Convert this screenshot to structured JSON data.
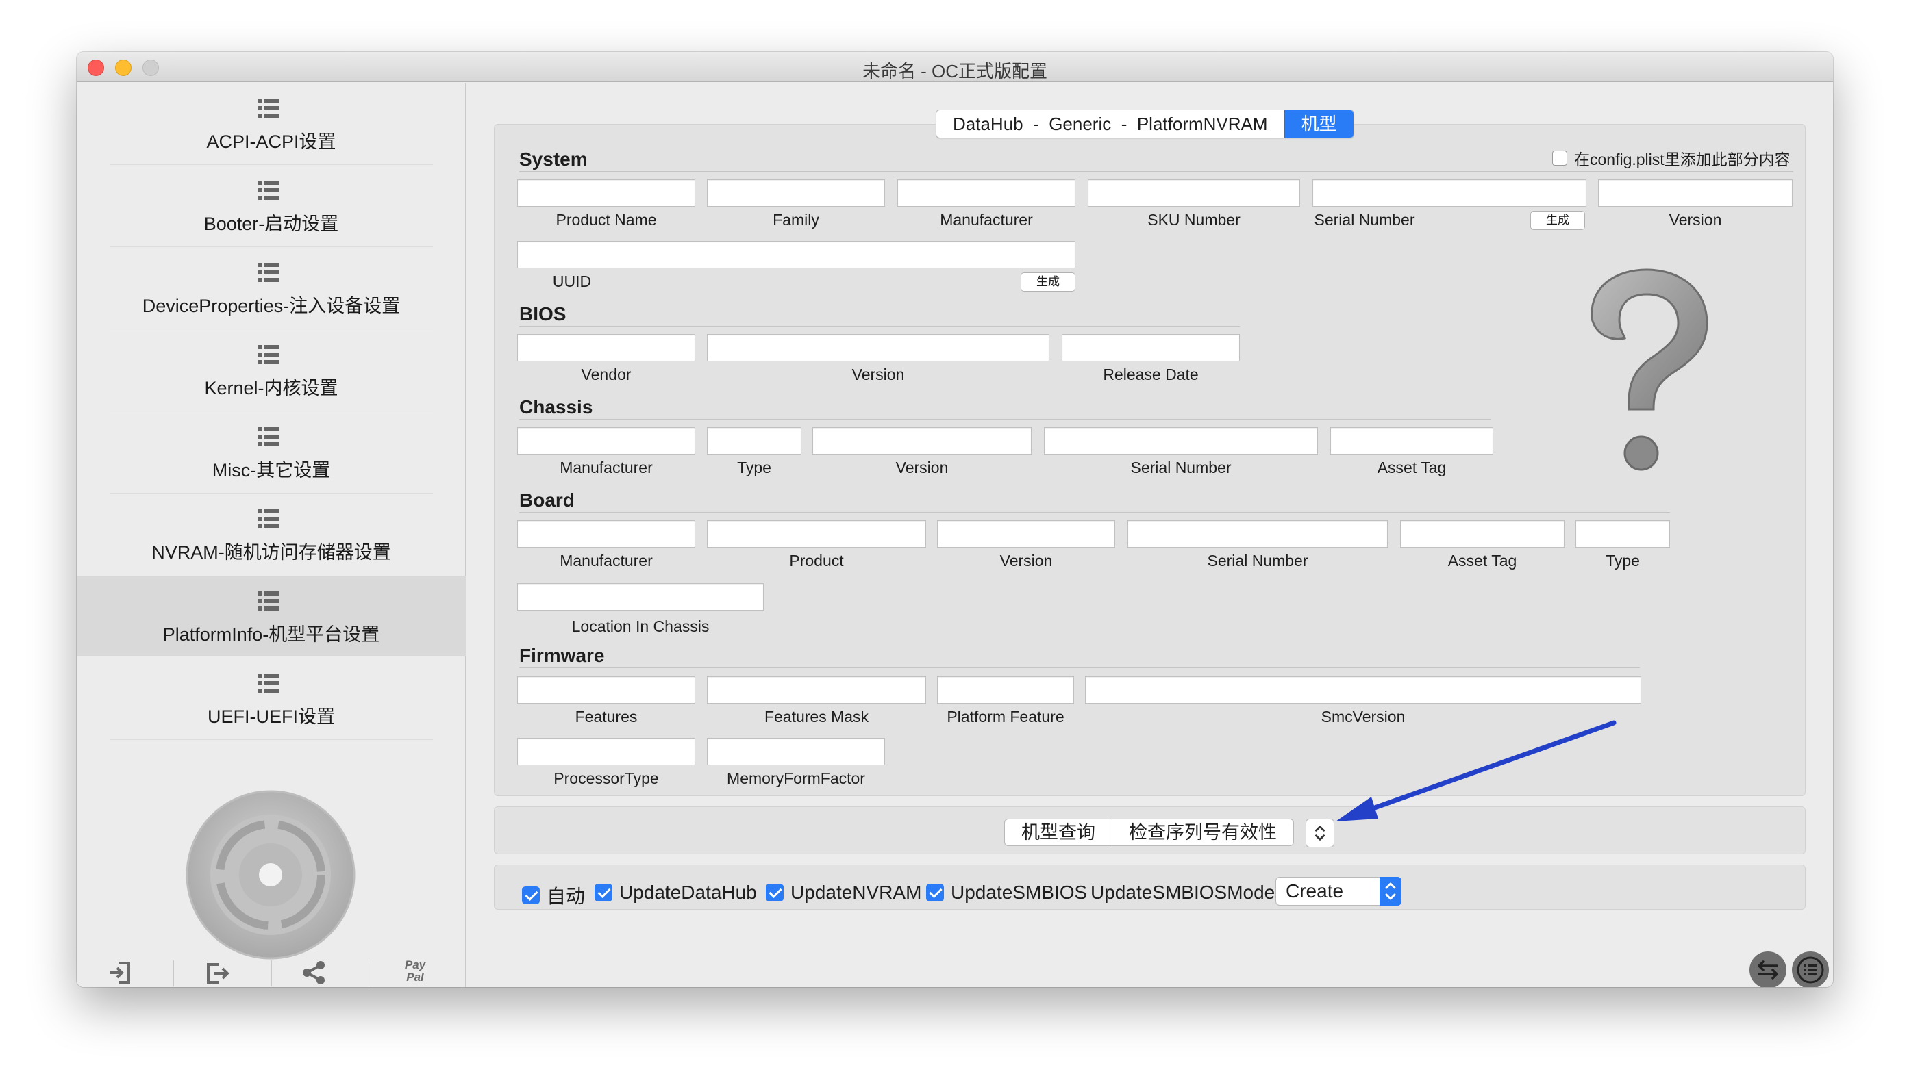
{
  "window": {
    "title": "未命名 - OC正式版配置"
  },
  "sidebar": {
    "items": [
      {
        "label": "ACPI-ACPI设置"
      },
      {
        "label": "Booter-启动设置"
      },
      {
        "label": "DeviceProperties-注入设备设置"
      },
      {
        "label": "Kernel-内核设置"
      },
      {
        "label": "Misc-其它设置"
      },
      {
        "label": "NVRAM-随机访问存储器设置"
      },
      {
        "label": "PlatformInfo-机型平台设置"
      },
      {
        "label": "UEFI-UEFI设置"
      }
    ],
    "selected_index": 6,
    "paypal_label": "Pay Pal"
  },
  "tabs": {
    "items": [
      "DataHub",
      "-",
      "Generic",
      "-",
      "PlatformNVRAM"
    ],
    "active": "机型"
  },
  "system": {
    "title": "System",
    "add_checkbox_label": "在config.plist里添加此部分内容",
    "add_checkbox_checked": false,
    "fields": [
      "Product Name",
      "Family",
      "Manufacturer",
      "SKU Number",
      "Serial Number",
      "Version",
      "UUID"
    ],
    "generate_label": "生成"
  },
  "bios": {
    "title": "BIOS",
    "fields": [
      "Vendor",
      "Version",
      "Release Date"
    ]
  },
  "chassis": {
    "title": "Chassis",
    "fields": [
      "Manufacturer",
      "Type",
      "Version",
      "Serial Number",
      "Asset Tag"
    ]
  },
  "board": {
    "title": "Board",
    "fields": [
      "Manufacturer",
      "Product",
      "Version",
      "Serial Number",
      "Asset Tag",
      "Type",
      "Location In Chassis"
    ]
  },
  "firmware": {
    "title": "Firmware",
    "fields": [
      "Features",
      "Features Mask",
      "Platform Feature",
      "SmcVersion",
      "ProcessorType",
      "MemoryFormFactor"
    ]
  },
  "actions": {
    "lookup_label": "机型查询",
    "check_serial_label": "检查序列号有效性"
  },
  "options": {
    "auto_label": "自动",
    "update_datahub_label": "UpdateDataHub",
    "update_nvram_label": "UpdateNVRAM",
    "update_smbios_label": "UpdateSMBIOS",
    "update_smbios_mode_label": "UpdateSMBIOSMode",
    "update_smbios_mode_value": "Create"
  },
  "colors": {
    "accent": "#2a7bf6",
    "annotation_arrow": "#2340c8"
  }
}
